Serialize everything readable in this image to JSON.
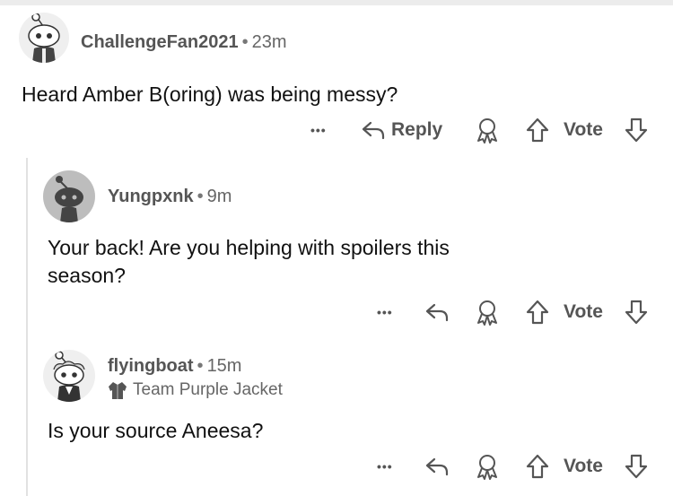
{
  "comments": [
    {
      "username": "ChallengeFan2021",
      "separator": "•",
      "time": "23m",
      "body": "Heard Amber B(oring) was being messy?",
      "actions": {
        "more": "•••",
        "reply": "Reply",
        "vote": "Vote"
      }
    },
    {
      "username": "Yungpxnk",
      "separator": "•",
      "time": "9m",
      "body_lines": [
        "Your back! Are you helping with spoilers this",
        "season?"
      ],
      "actions": {
        "more": "•••",
        "vote": "Vote"
      }
    },
    {
      "username": "flyingboat",
      "separator": "•",
      "time": "15m",
      "flair": "Team Purple Jacket",
      "body": "Is your source Aneesa?",
      "actions": {
        "more": "•••",
        "vote": "Vote"
      }
    }
  ],
  "icons": {
    "avatar": "snoo-avatar-icon",
    "reply": "reply-arrow-icon",
    "award": "award-icon",
    "upvote": "upvote-arrow-icon",
    "downvote": "downvote-arrow-icon",
    "flair": "jacket-icon"
  },
  "colors": {
    "text": "#1c1c1c",
    "muted": "#555555",
    "thread_line": "#e2e2e2"
  }
}
